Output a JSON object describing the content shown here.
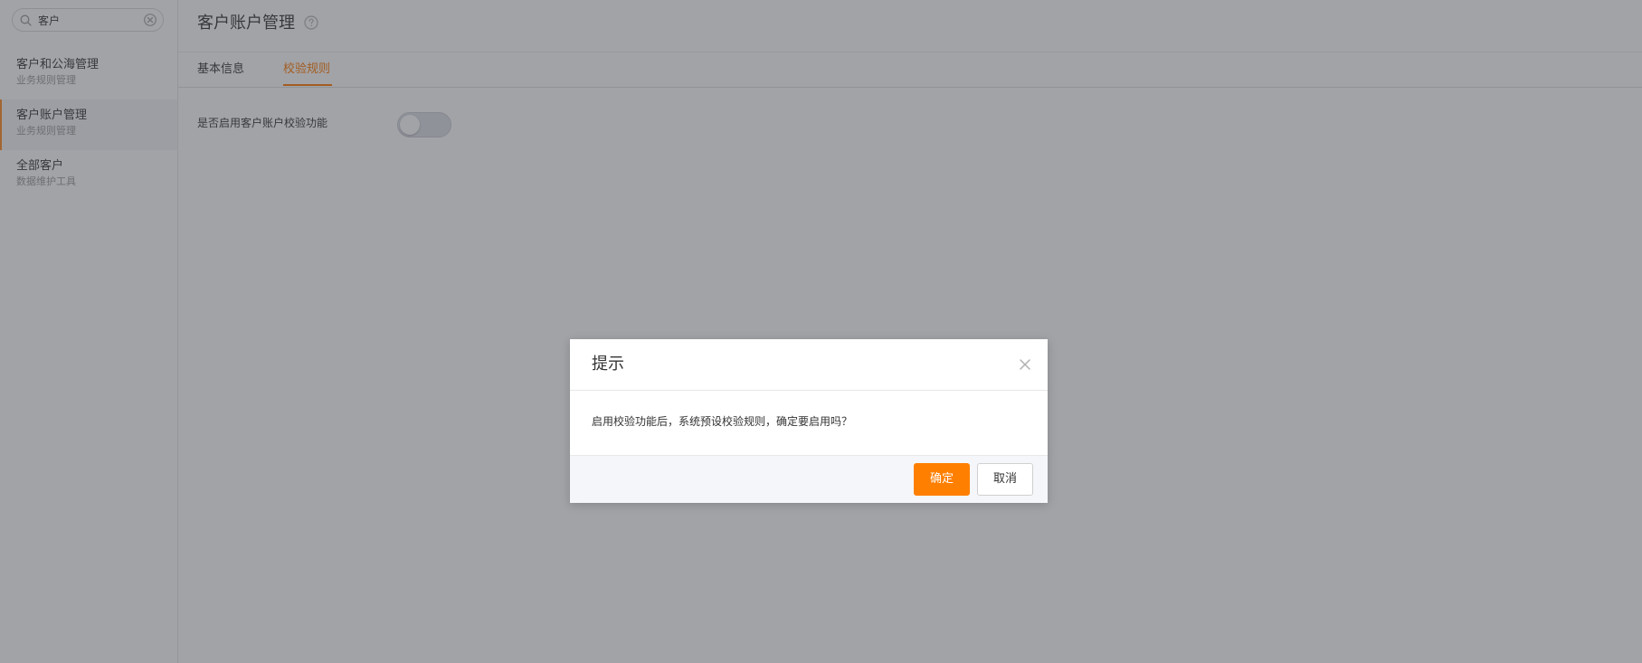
{
  "sidebar": {
    "search": {
      "value": "客户",
      "placeholder": ""
    },
    "items": [
      {
        "title": "客户和公海管理",
        "subtitle": "业务规则管理",
        "active": false
      },
      {
        "title": "客户账户管理",
        "subtitle": "业务规则管理",
        "active": true
      },
      {
        "title": "全部客户",
        "subtitle": "数据维护工具",
        "active": false
      }
    ]
  },
  "header": {
    "title": "客户账户管理",
    "help_icon": "question-circle-icon"
  },
  "tabs": [
    {
      "label": "基本信息",
      "active": false
    },
    {
      "label": "校验规则",
      "active": true
    }
  ],
  "form": {
    "toggle_label": "是否启用客户账户校验功能",
    "toggle_on": false
  },
  "dialog": {
    "title": "提示",
    "message": "启用校验功能后，系统预设校验规则，确定要启用吗？",
    "confirm_label": "确定",
    "cancel_label": "取消",
    "close_icon": "close-icon"
  },
  "colors": {
    "accent": "#ff7f00",
    "overlay": "rgba(60,62,72,0.48)",
    "toggle_off": "#dcdfe6"
  }
}
